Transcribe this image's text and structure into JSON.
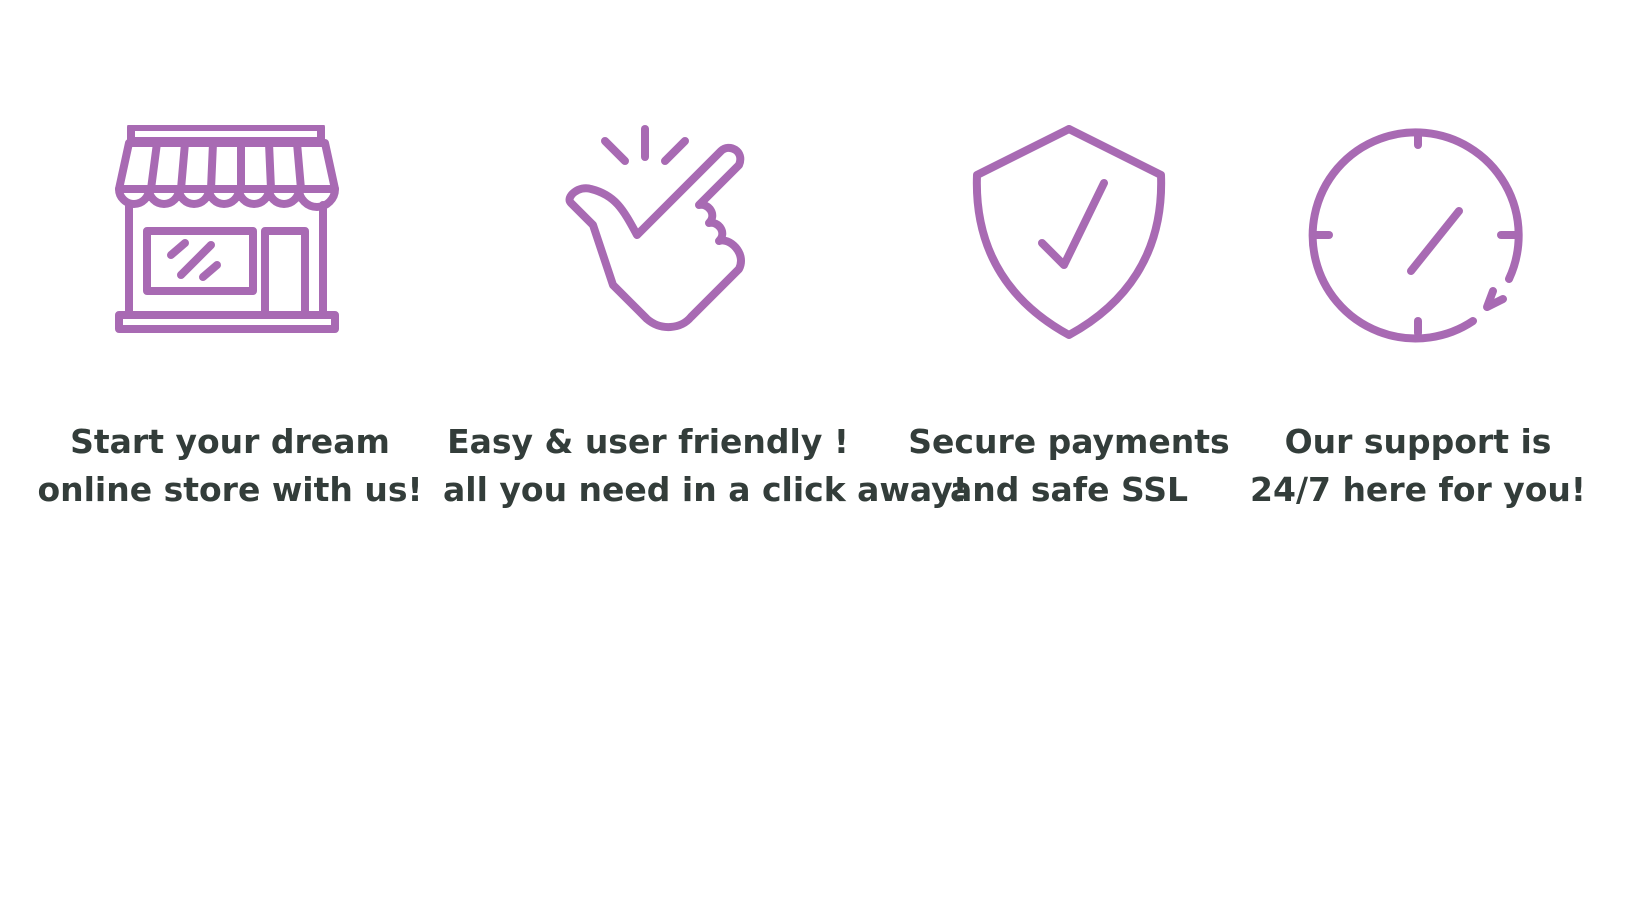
{
  "theme": {
    "icon_color": "#a86ab3",
    "text_color": "#333d3a"
  },
  "features": [
    {
      "icon": "storefront-icon",
      "line1": "Start your dream",
      "line2": "online store with us!"
    },
    {
      "icon": "finger-snap-icon",
      "line1": "Easy & user friendly !",
      "line2": "all you need in a click away!"
    },
    {
      "icon": "shield-check-icon",
      "line1": "Secure payments",
      "line2": "and safe SSL"
    },
    {
      "icon": "clock-24-7-icon",
      "line1": "Our support is",
      "line2": "24/7 here for you!"
    }
  ]
}
